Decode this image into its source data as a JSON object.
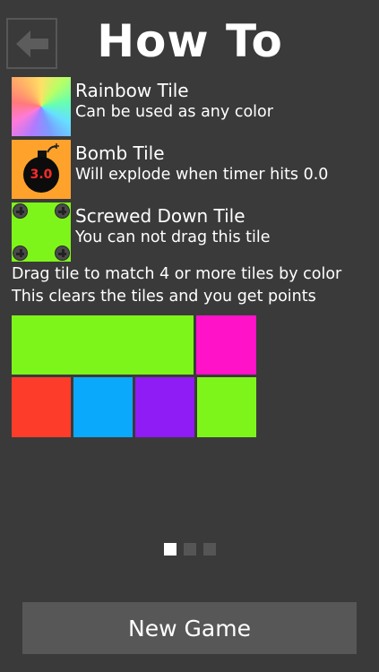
{
  "header": {
    "title": "How To",
    "back_icon": "arrow-left-icon"
  },
  "tiles": [
    {
      "name": "Rainbow Tile",
      "description": "Can be used as any color",
      "icon": "rainbow-tile-icon"
    },
    {
      "name": "Bomb Tile",
      "description": "Will explode when timer hits 0.0",
      "icon": "bomb-icon",
      "timer": "3.0"
    },
    {
      "name": "Screwed Down Tile",
      "description": "You can not drag this tile",
      "icon": "screw-icon"
    }
  ],
  "instructions": [
    "Drag tile to match 4 or more tiles by color",
    "This clears the tiles and you get points"
  ],
  "colors": {
    "background": "#3a3a3a",
    "green": "#7ef51a",
    "magenta": "#ff12c8",
    "red": "#fd3d2a",
    "blue": "#0ba9fb",
    "purple": "#8f1bf5",
    "orange": "#ffa22c",
    "button": "#575757"
  },
  "pager": {
    "pages": 3,
    "current": 1
  },
  "footer": {
    "new_game_label": "New Game"
  }
}
